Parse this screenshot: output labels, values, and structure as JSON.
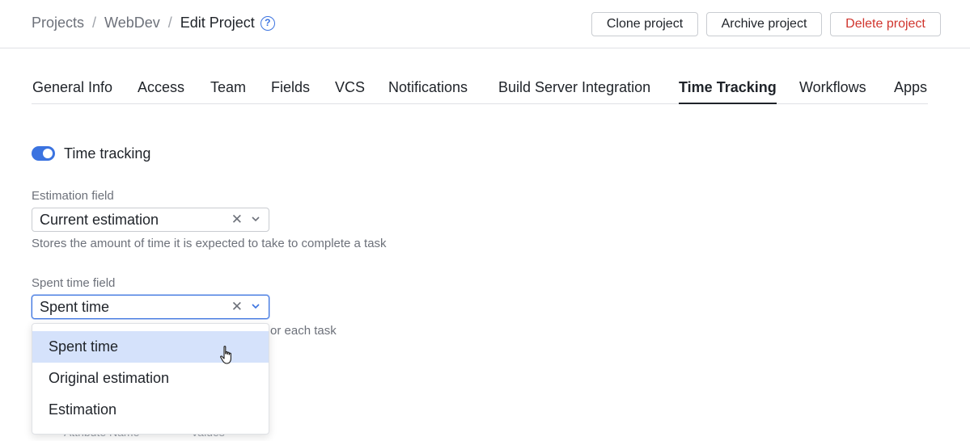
{
  "breadcrumb": {
    "items": [
      "Projects",
      "WebDev",
      "Edit Project"
    ],
    "separator": "/"
  },
  "header_actions": {
    "clone": "Clone project",
    "archive": "Archive project",
    "delete": "Delete project"
  },
  "tabs": [
    "General Info",
    "Access",
    "Team",
    "Fields",
    "VCS",
    "Notifications",
    "Build Server Integration",
    "Time Tracking",
    "Workflows",
    "Apps"
  ],
  "active_tab": "Time Tracking",
  "time_tracking": {
    "label": "Time tracking",
    "enabled": true
  },
  "estimation": {
    "label": "Estimation field",
    "value": "Current estimation",
    "hint": "Stores the amount of time it is expected to take to complete a task"
  },
  "spent_time": {
    "label": "Spent time field",
    "value": "Spent time",
    "hint_visible": "or each task"
  },
  "dropdown": {
    "options": [
      "Spent time",
      "Original estimation",
      "Estimation"
    ],
    "hovered": "Spent time"
  },
  "table_header_partial": {
    "col1": "Attribute Name",
    "col2": "Values"
  },
  "colors": {
    "accent": "#3b73e0",
    "danger": "#d0352e",
    "hover": "#d5e2fb"
  }
}
